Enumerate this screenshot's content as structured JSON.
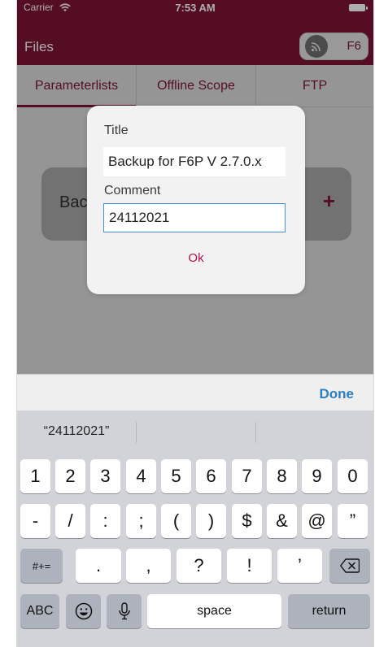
{
  "status": {
    "carrier": "Carrier",
    "time": "7:53 AM"
  },
  "header": {
    "title": "Files",
    "device": "F6",
    "cast_icon": "cast-icon"
  },
  "tabs": [
    {
      "label": "Parameterlists"
    },
    {
      "label": "Offline Scope"
    },
    {
      "label": "FTP"
    }
  ],
  "background_card": {
    "text": "Bac",
    "add_icon": "+"
  },
  "dialog": {
    "title_label": "Title",
    "title_value": "Backup for F6P V 2.7.0.x",
    "comment_label": "Comment",
    "comment_value": "24112021",
    "ok_label": "Ok"
  },
  "accessory": {
    "done_label": "Done"
  },
  "keyboard": {
    "suggestions": [
      "“24112021”",
      "",
      ""
    ],
    "row1": [
      "1",
      "2",
      "3",
      "4",
      "5",
      "6",
      "7",
      "8",
      "9",
      "0"
    ],
    "row2": [
      "-",
      "/",
      ":",
      ";",
      "(",
      ")",
      "$",
      "&",
      "@",
      "”"
    ],
    "row3_left": "#+=",
    "row3": [
      ".",
      ",",
      "?",
      "!",
      "’"
    ],
    "abc": "ABC",
    "space": "space",
    "return": "return",
    "emoji_icon": "emoji-icon",
    "mic_icon": "microphone-icon",
    "delete_icon": "delete-icon"
  },
  "colors": {
    "brand": "#7d1434",
    "accent_blue": "#2a7fc3",
    "ok_red": "#b0104c"
  }
}
